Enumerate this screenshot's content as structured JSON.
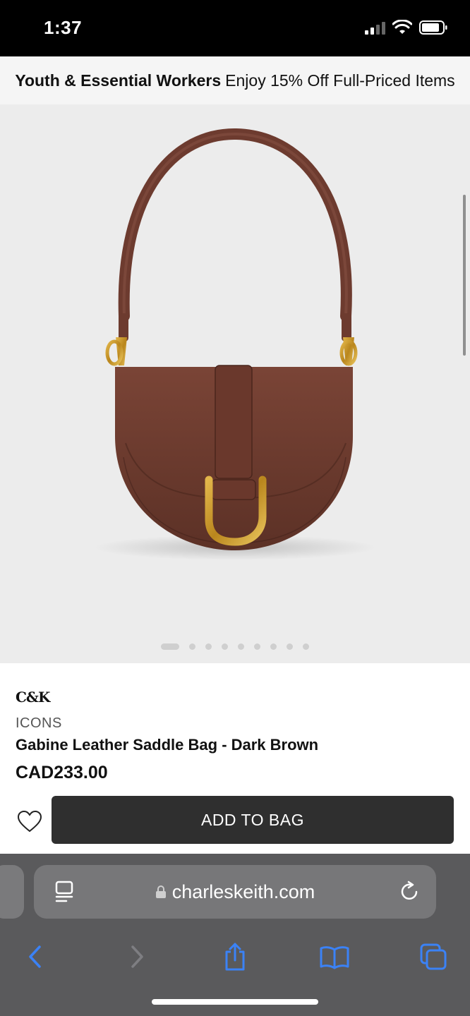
{
  "status_bar": {
    "time": "1:37"
  },
  "promo": {
    "bold": "Youth & Essential Workers",
    "text": "Enjoy 15% Off Full-Priced Items"
  },
  "gallery": {
    "image_count": 9,
    "active_index": 0
  },
  "product": {
    "brand_logo": "C&K",
    "category": "ICONS",
    "name": "Gabine Leather Saddle Bag - Dark Brown",
    "price": "CAD233.00"
  },
  "actions": {
    "add_to_bag": "ADD TO BAG"
  },
  "browser": {
    "url": "charleskeith.com"
  },
  "colors": {
    "bag": "#6b3a2e",
    "hardware": "#c89a2b",
    "button": "#2f2f2f",
    "safari_bar": "#5a5a5c",
    "accent_blue": "#3b82f6"
  }
}
